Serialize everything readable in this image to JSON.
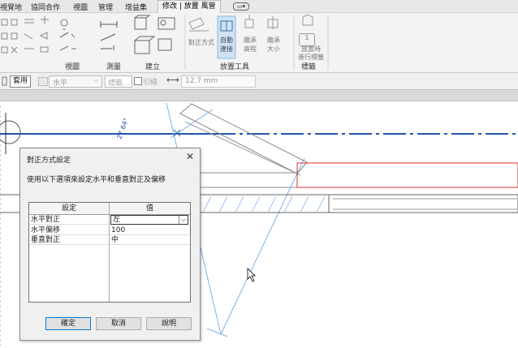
{
  "ribbon_tabs": [
    "視覺地",
    "協同合作",
    "視圖",
    "管理",
    "增益集",
    "修改 | 放置 風管"
  ],
  "ribbon_groups": {
    "view": "視圖",
    "measure": "測量",
    "create": "建立",
    "placement_tools": "放置工具",
    "tag": "標籤"
  },
  "ribbon_buttons": {
    "justification": "對正方式",
    "auto_connect_1": "自動",
    "auto_connect_2": "連接",
    "inherit_elev_1": "繼承",
    "inherit_elev_2": "高程",
    "inherit_size_1": "繼承",
    "inherit_size_2": "大小",
    "tag_on_place_1": "放置時",
    "tag_on_place_2": "進行標籤",
    "tag_number": "1"
  },
  "options_bar": {
    "apply_label": "套用",
    "orientation_value": "水平",
    "tag_field_placeholder": "標籤...",
    "leader_label": "引線",
    "dimension_value": "12.7 mm"
  },
  "canvas": {
    "angle_label": "27.64°"
  },
  "dialog": {
    "title": "對正方式設定",
    "close_symbol": "✕",
    "description": "使用以下選項來設定水平和垂直對正及偏移",
    "grid": {
      "col_setting": "設定",
      "col_value": "值",
      "rows": [
        {
          "setting": "水平對正",
          "value": "左"
        },
        {
          "setting": "水平偏移",
          "value": "100"
        },
        {
          "setting": "垂直對正",
          "value": "中"
        }
      ]
    },
    "buttons": {
      "ok": "確定",
      "cancel": "取消",
      "help": "說明"
    }
  },
  "colors": {
    "duct_red": "#e03030",
    "grid_blue": "#2255aa",
    "ref_line_blue": "#7fb2e8",
    "active_tab_bg": "#cfe3f5"
  }
}
